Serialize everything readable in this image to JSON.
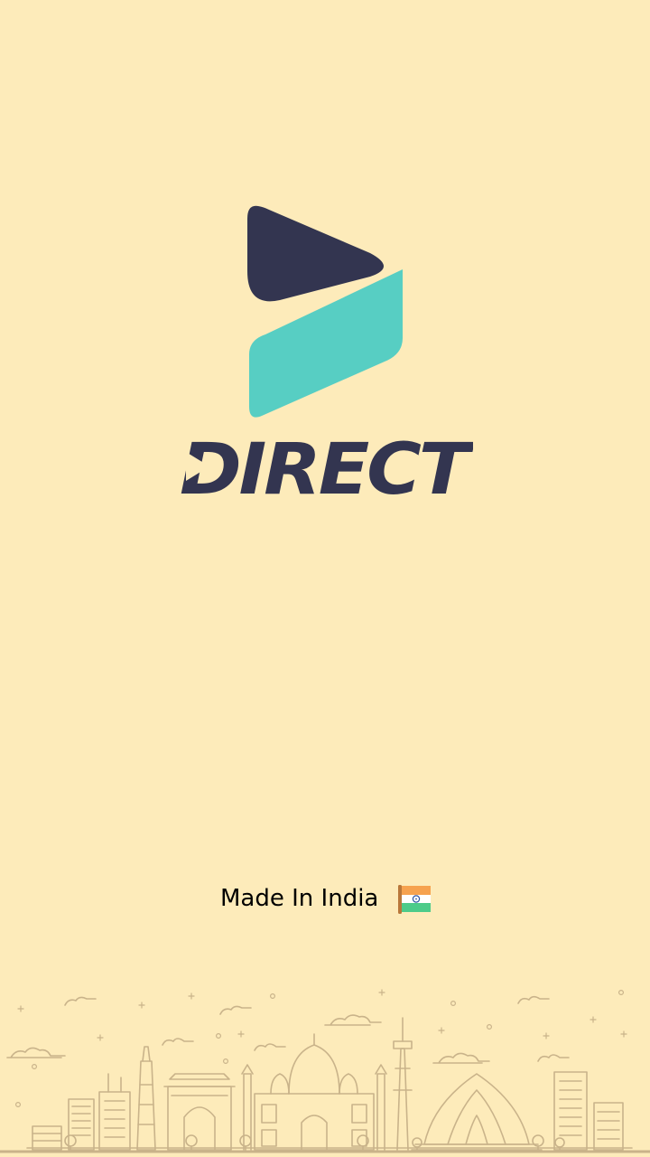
{
  "brand": {
    "name": "DIRECT",
    "colors": {
      "navy": "#333550",
      "teal": "#57CEC3",
      "background": "#FDEBBA",
      "line_art": "#C9B38A"
    }
  },
  "footer": {
    "made_in": "Made In India",
    "flag_icon": "india-flag-icon"
  }
}
